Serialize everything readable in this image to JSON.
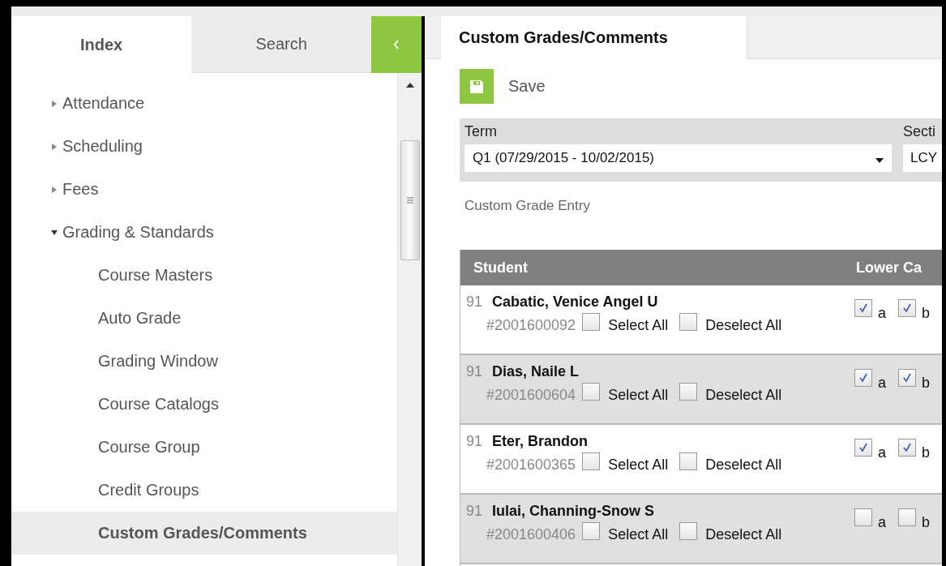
{
  "sidebar": {
    "tabs": [
      {
        "label": "Index",
        "selected": true
      },
      {
        "label": "Search",
        "selected": false
      }
    ],
    "tree": [
      {
        "label": "Attendance",
        "expanded": false,
        "selected": false
      },
      {
        "label": "Scheduling",
        "expanded": false,
        "selected": false
      },
      {
        "label": "Fees",
        "expanded": false,
        "selected": false
      },
      {
        "label": "Grading & Standards",
        "expanded": true,
        "selected": false,
        "children": [
          {
            "label": "Course Masters",
            "selected": false
          },
          {
            "label": "Auto Grade",
            "selected": false
          },
          {
            "label": "Grading Window",
            "selected": false
          },
          {
            "label": "Course Catalogs",
            "selected": false
          },
          {
            "label": "Course Group",
            "selected": false
          },
          {
            "label": "Credit Groups",
            "selected": false
          },
          {
            "label": "Custom Grades/Comments",
            "selected": true
          }
        ]
      }
    ]
  },
  "main": {
    "tab": "Custom Grades/Comments",
    "save_label": "Save",
    "filters": [
      {
        "label": "Term",
        "value": "Q1 (07/29/2015 - 10/02/2015)",
        "kind": "dropdown"
      },
      {
        "label": "Secti",
        "value": "LCY",
        "kind": "field"
      }
    ],
    "section_title": "Custom Grade Entry",
    "table": {
      "columns": [
        "Student",
        "Lower Ca"
      ],
      "rows": [
        {
          "number": "91",
          "name": "Cabatic, Venice Angel U",
          "student_id": "#2001600092",
          "select_all": {
            "label": "Select All",
            "checked": false
          },
          "deselect_all": {
            "label": "Deselect All",
            "checked": false
          },
          "grades": [
            {
              "label": "a",
              "checked": true
            },
            {
              "label": "b",
              "checked": true
            }
          ]
        },
        {
          "number": "91",
          "name": "Dias, Naile L",
          "student_id": "#2001600604",
          "select_all": {
            "label": "Select All",
            "checked": false
          },
          "deselect_all": {
            "label": "Deselect All",
            "checked": false
          },
          "grades": [
            {
              "label": "a",
              "checked": true
            },
            {
              "label": "b",
              "checked": true
            }
          ]
        },
        {
          "number": "91",
          "name": "Eter, Brandon",
          "student_id": "#2001600365",
          "select_all": {
            "label": "Select All",
            "checked": false
          },
          "deselect_all": {
            "label": "Deselect All",
            "checked": false
          },
          "grades": [
            {
              "label": "a",
              "checked": true
            },
            {
              "label": "b",
              "checked": true
            }
          ]
        },
        {
          "number": "91",
          "name": "Iulai, Channing-Snow S",
          "student_id": "#2001600406",
          "select_all": {
            "label": "Select All",
            "checked": false
          },
          "deselect_all": {
            "label": "Deselect All",
            "checked": false
          },
          "grades": [
            {
              "label": "a",
              "checked": false
            },
            {
              "label": "b",
              "checked": false
            }
          ]
        }
      ]
    }
  }
}
